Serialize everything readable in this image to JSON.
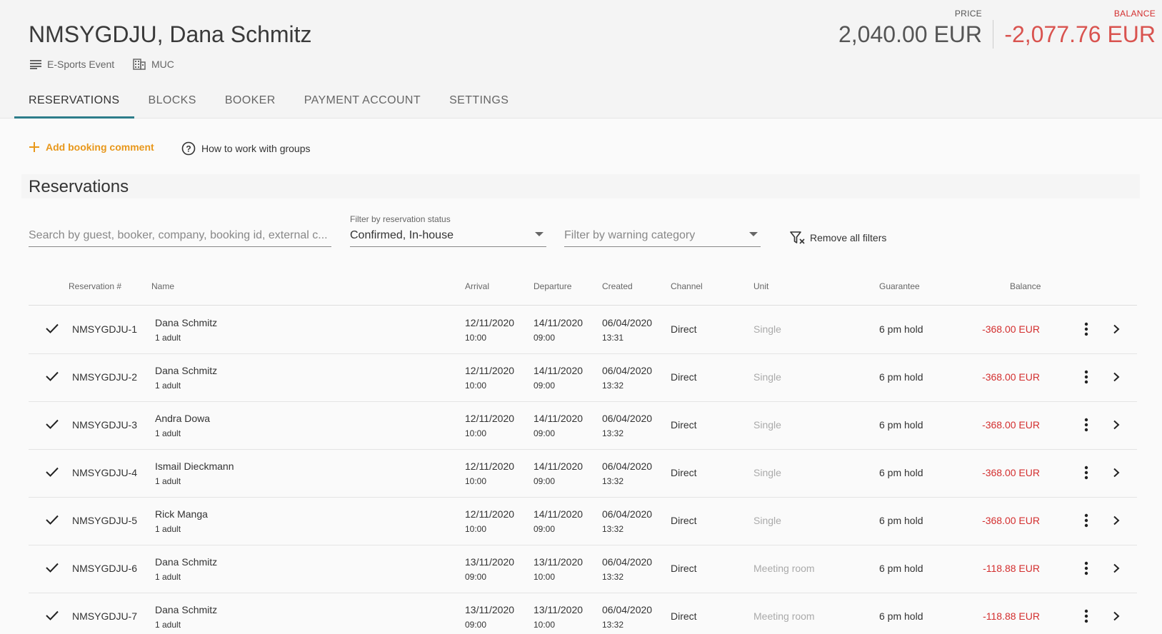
{
  "header": {
    "title": "NMSYGDJU, Dana Schmitz",
    "meta": [
      {
        "icon": "description-icon",
        "label": "E-Sports Event"
      },
      {
        "icon": "building-icon",
        "label": "MUC"
      }
    ],
    "price_label": "PRICE",
    "price_value": "2,040.00 EUR",
    "balance_label": "BALANCE",
    "balance_value": "-2,077.76 EUR",
    "balance_color": "#d32f2f"
  },
  "tabs": [
    {
      "label": "RESERVATIONS",
      "active": true
    },
    {
      "label": "BLOCKS",
      "active": false
    },
    {
      "label": "BOOKER",
      "active": false
    },
    {
      "label": "PAYMENT ACCOUNT",
      "active": false
    },
    {
      "label": "SETTINGS",
      "active": false
    }
  ],
  "actions": {
    "add_comment": "Add booking comment",
    "howto": "How to work with groups",
    "accent_color": "#e8971a"
  },
  "section_title": "Reservations",
  "filters": {
    "search_placeholder": "Search by guest, booker, company, booking id, external c...",
    "status_label": "Filter by reservation status",
    "status_value": "Confirmed, In-house",
    "warning_placeholder": "Filter by warning category",
    "remove_all": "Remove all filters"
  },
  "table": {
    "columns": [
      "Reservation #",
      "Name",
      "Arrival",
      "Departure",
      "Created",
      "Channel",
      "Unit",
      "Guarantee",
      "Balance"
    ],
    "rows": [
      {
        "id": "NMSYGDJU-1",
        "name": "Dana Schmitz",
        "guests": "1 adult",
        "arrival_date": "12/11/2020",
        "arrival_time": "10:00",
        "departure_date": "14/11/2020",
        "departure_time": "09:00",
        "created_date": "06/04/2020",
        "created_time": "13:31",
        "channel": "Direct",
        "unit": "Single",
        "guarantee": "6 pm hold",
        "balance": "-368.00 EUR"
      },
      {
        "id": "NMSYGDJU-2",
        "name": "Dana Schmitz",
        "guests": "1 adult",
        "arrival_date": "12/11/2020",
        "arrival_time": "10:00",
        "departure_date": "14/11/2020",
        "departure_time": "09:00",
        "created_date": "06/04/2020",
        "created_time": "13:32",
        "channel": "Direct",
        "unit": "Single",
        "guarantee": "6 pm hold",
        "balance": "-368.00 EUR"
      },
      {
        "id": "NMSYGDJU-3",
        "name": "Andra Dowa",
        "guests": "1 adult",
        "arrival_date": "12/11/2020",
        "arrival_time": "10:00",
        "departure_date": "14/11/2020",
        "departure_time": "09:00",
        "created_date": "06/04/2020",
        "created_time": "13:32",
        "channel": "Direct",
        "unit": "Single",
        "guarantee": "6 pm hold",
        "balance": "-368.00 EUR"
      },
      {
        "id": "NMSYGDJU-4",
        "name": "Ismail Dieckmann",
        "guests": "1 adult",
        "arrival_date": "12/11/2020",
        "arrival_time": "10:00",
        "departure_date": "14/11/2020",
        "departure_time": "09:00",
        "created_date": "06/04/2020",
        "created_time": "13:32",
        "channel": "Direct",
        "unit": "Single",
        "guarantee": "6 pm hold",
        "balance": "-368.00 EUR"
      },
      {
        "id": "NMSYGDJU-5",
        "name": "Rick Manga",
        "guests": "1 adult",
        "arrival_date": "12/11/2020",
        "arrival_time": "10:00",
        "departure_date": "14/11/2020",
        "departure_time": "09:00",
        "created_date": "06/04/2020",
        "created_time": "13:32",
        "channel": "Direct",
        "unit": "Single",
        "guarantee": "6 pm hold",
        "balance": "-368.00 EUR"
      },
      {
        "id": "NMSYGDJU-6",
        "name": "Dana Schmitz",
        "guests": "1 adult",
        "arrival_date": "13/11/2020",
        "arrival_time": "09:00",
        "departure_date": "13/11/2020",
        "departure_time": "10:00",
        "created_date": "06/04/2020",
        "created_time": "13:32",
        "channel": "Direct",
        "unit": "Meeting room",
        "guarantee": "6 pm hold",
        "balance": "-118.88 EUR"
      },
      {
        "id": "NMSYGDJU-7",
        "name": "Dana Schmitz",
        "guests": "1 adult",
        "arrival_date": "13/11/2020",
        "arrival_time": "09:00",
        "departure_date": "13/11/2020",
        "departure_time": "10:00",
        "created_date": "06/04/2020",
        "created_time": "13:32",
        "channel": "Direct",
        "unit": "Meeting room",
        "guarantee": "6 pm hold",
        "balance": "-118.88 EUR"
      }
    ]
  }
}
